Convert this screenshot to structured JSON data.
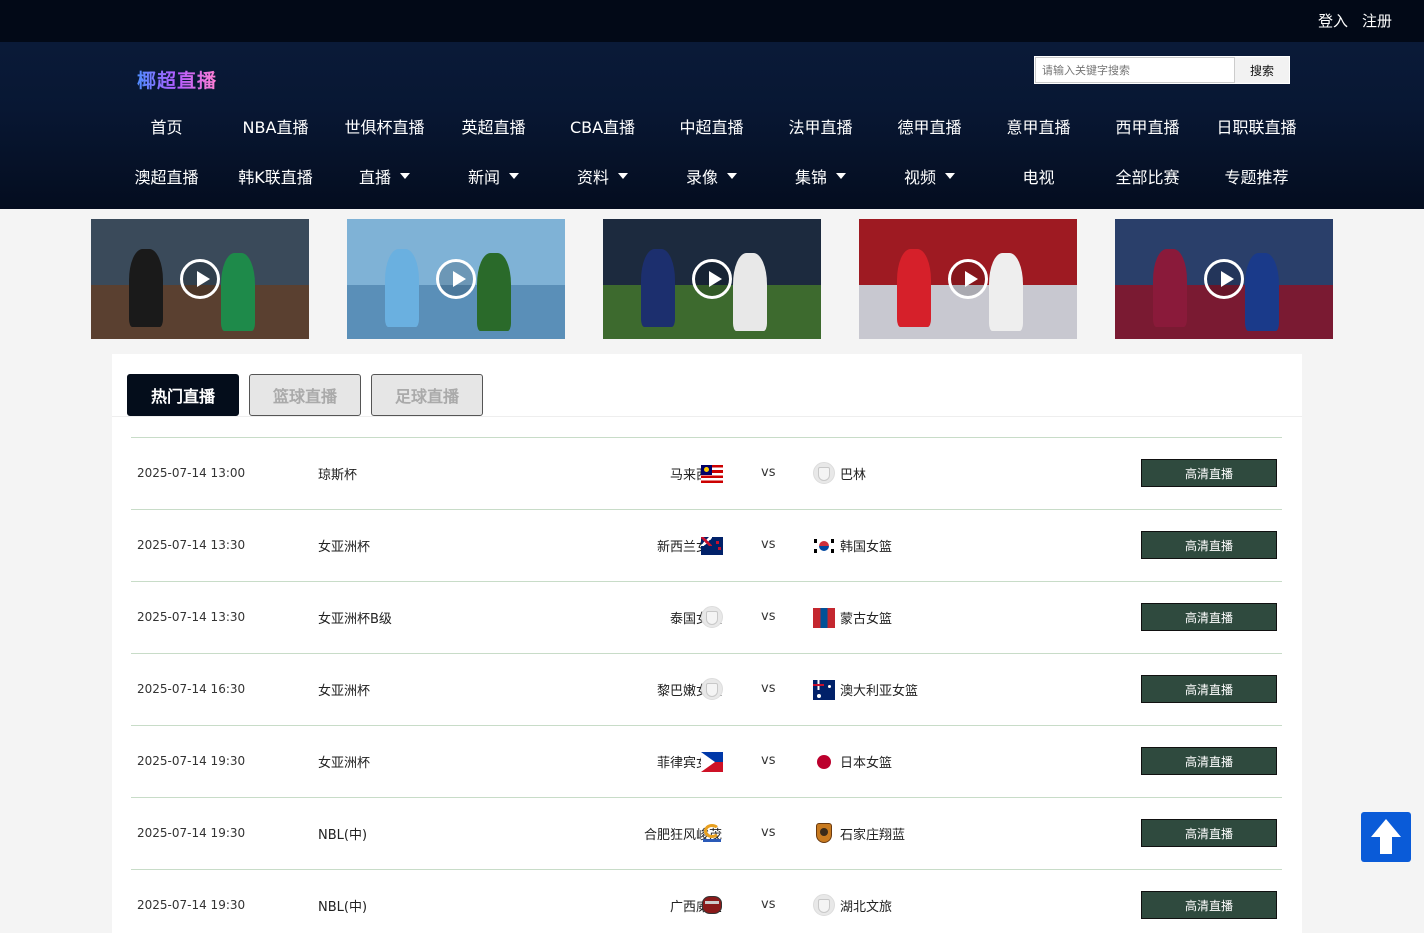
{
  "top_bar": {
    "login": "登入",
    "register": "注册"
  },
  "site": {
    "logo_text": "椰超直播"
  },
  "search": {
    "placeholder": "请输入关键字搜索",
    "button": "搜索"
  },
  "nav_row1": [
    "首页",
    "NBA直播",
    "世俱杯直播",
    "英超直播",
    "CBA直播",
    "中超直播",
    "法甲直播",
    "德甲直播",
    "意甲直播",
    "西甲直播",
    "日职联直播"
  ],
  "nav_row2": [
    {
      "label": "澳超直播",
      "dropdown": false
    },
    {
      "label": "韩K联直播",
      "dropdown": false
    },
    {
      "label": "直播",
      "dropdown": true
    },
    {
      "label": "新闻",
      "dropdown": true
    },
    {
      "label": "资料",
      "dropdown": true
    },
    {
      "label": "录像",
      "dropdown": true
    },
    {
      "label": "集锦",
      "dropdown": true
    },
    {
      "label": "视频",
      "dropdown": true
    },
    {
      "label": "电视",
      "dropdown": false
    },
    {
      "label": "全部比赛",
      "dropdown": false
    },
    {
      "label": "专题推荐",
      "dropdown": false
    }
  ],
  "thumbnails": [
    {
      "icon": "play-icon",
      "sky": "#3a4a5a",
      "field": "#5a4030"
    },
    {
      "icon": "play-icon",
      "sky": "#7fb2d6",
      "field": "#5a8fb8"
    },
    {
      "icon": "play-icon",
      "sky": "#1c2a3e",
      "field": "#3d6a2e"
    },
    {
      "icon": "play-icon",
      "sky": "#9e1a22",
      "field": "#c8c8d0"
    },
    {
      "icon": "play-icon",
      "sky": "#2a3f6a",
      "field": "#7a1a32"
    }
  ],
  "tabs": [
    {
      "label": "热门直播",
      "active": true
    },
    {
      "label": "篮球直播",
      "active": false
    },
    {
      "label": "足球直播",
      "active": false
    }
  ],
  "matches": [
    {
      "time": "2025-07-14 13:00",
      "league": "琼斯杯",
      "home": "马来西亚",
      "home_flag": "malaysia-flag-icon",
      "vs": "vs",
      "away": "巴林",
      "away_flag": "placeholder-crest-icon",
      "button": "高清直播"
    },
    {
      "time": "2025-07-14 13:30",
      "league": "女亚洲杯",
      "home": "新西兰女篮",
      "home_flag": "new-zealand-flag-icon",
      "vs": "vs",
      "away": "韩国女篮",
      "away_flag": "south-korea-flag-icon",
      "button": "高清直播"
    },
    {
      "time": "2025-07-14 13:30",
      "league": "女亚洲杯B级",
      "home": "泰国女篮",
      "home_flag": "placeholder-crest-icon",
      "vs": "vs",
      "away": "蒙古女篮",
      "away_flag": "mongolia-flag-icon",
      "button": "高清直播"
    },
    {
      "time": "2025-07-14 16:30",
      "league": "女亚洲杯",
      "home": "黎巴嫩女篮",
      "home_flag": "placeholder-crest-icon",
      "vs": "vs",
      "away": "澳大利亚女篮",
      "away_flag": "australia-flag-icon",
      "button": "高清直播"
    },
    {
      "time": "2025-07-14 19:30",
      "league": "女亚洲杯",
      "home": "菲律宾女篮",
      "home_flag": "philippines-flag-icon",
      "vs": "vs",
      "away": "日本女篮",
      "away_flag": "japan-flag-icon",
      "button": "高清直播"
    },
    {
      "time": "2025-07-14 19:30",
      "league": "NBL(中)",
      "home": "合肥狂风峻茂",
      "home_flag": "hefei-team-logo-icon",
      "vs": "vs",
      "away": "石家庄翔蓝",
      "away_flag": "shijiazhuang-team-logo-icon",
      "button": "高清直播"
    },
    {
      "time": "2025-07-14 19:30",
      "league": "NBL(中)",
      "home": "广西威壮",
      "home_flag": "guangxi-team-logo-icon",
      "vs": "vs",
      "away": "湖北文旅",
      "away_flag": "placeholder-crest-icon",
      "button": "高清直播"
    }
  ],
  "back_to_top": {
    "icon": "arrow-up-icon"
  }
}
